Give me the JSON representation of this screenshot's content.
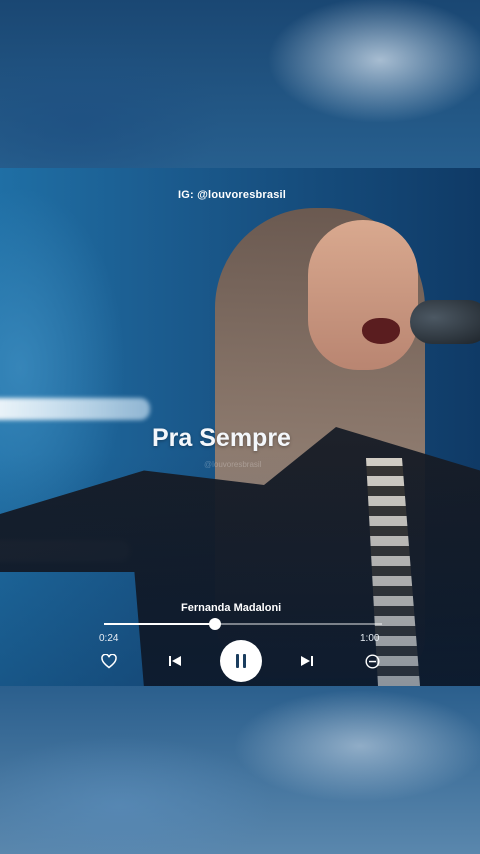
{
  "overlay": {
    "instagram_handle": "IG: @louvoresbrasil",
    "watermark": "@louvoresbrasil"
  },
  "player": {
    "song_title": "Pra Sempre",
    "artist": "Fernanda Madaloni",
    "elapsed_time": "0:24",
    "total_time": "1:00",
    "progress_fraction": 0.4,
    "state": "playing"
  },
  "icons": {
    "favorite": "heart-outline-icon",
    "previous": "skip-previous-icon",
    "play_pause": "pause-icon",
    "next": "skip-next-icon",
    "remove": "minus-circle-icon"
  },
  "colors": {
    "accent": "#ffffff",
    "card_blue": "#1b5b8e",
    "background_blue": "#1d4a74"
  }
}
